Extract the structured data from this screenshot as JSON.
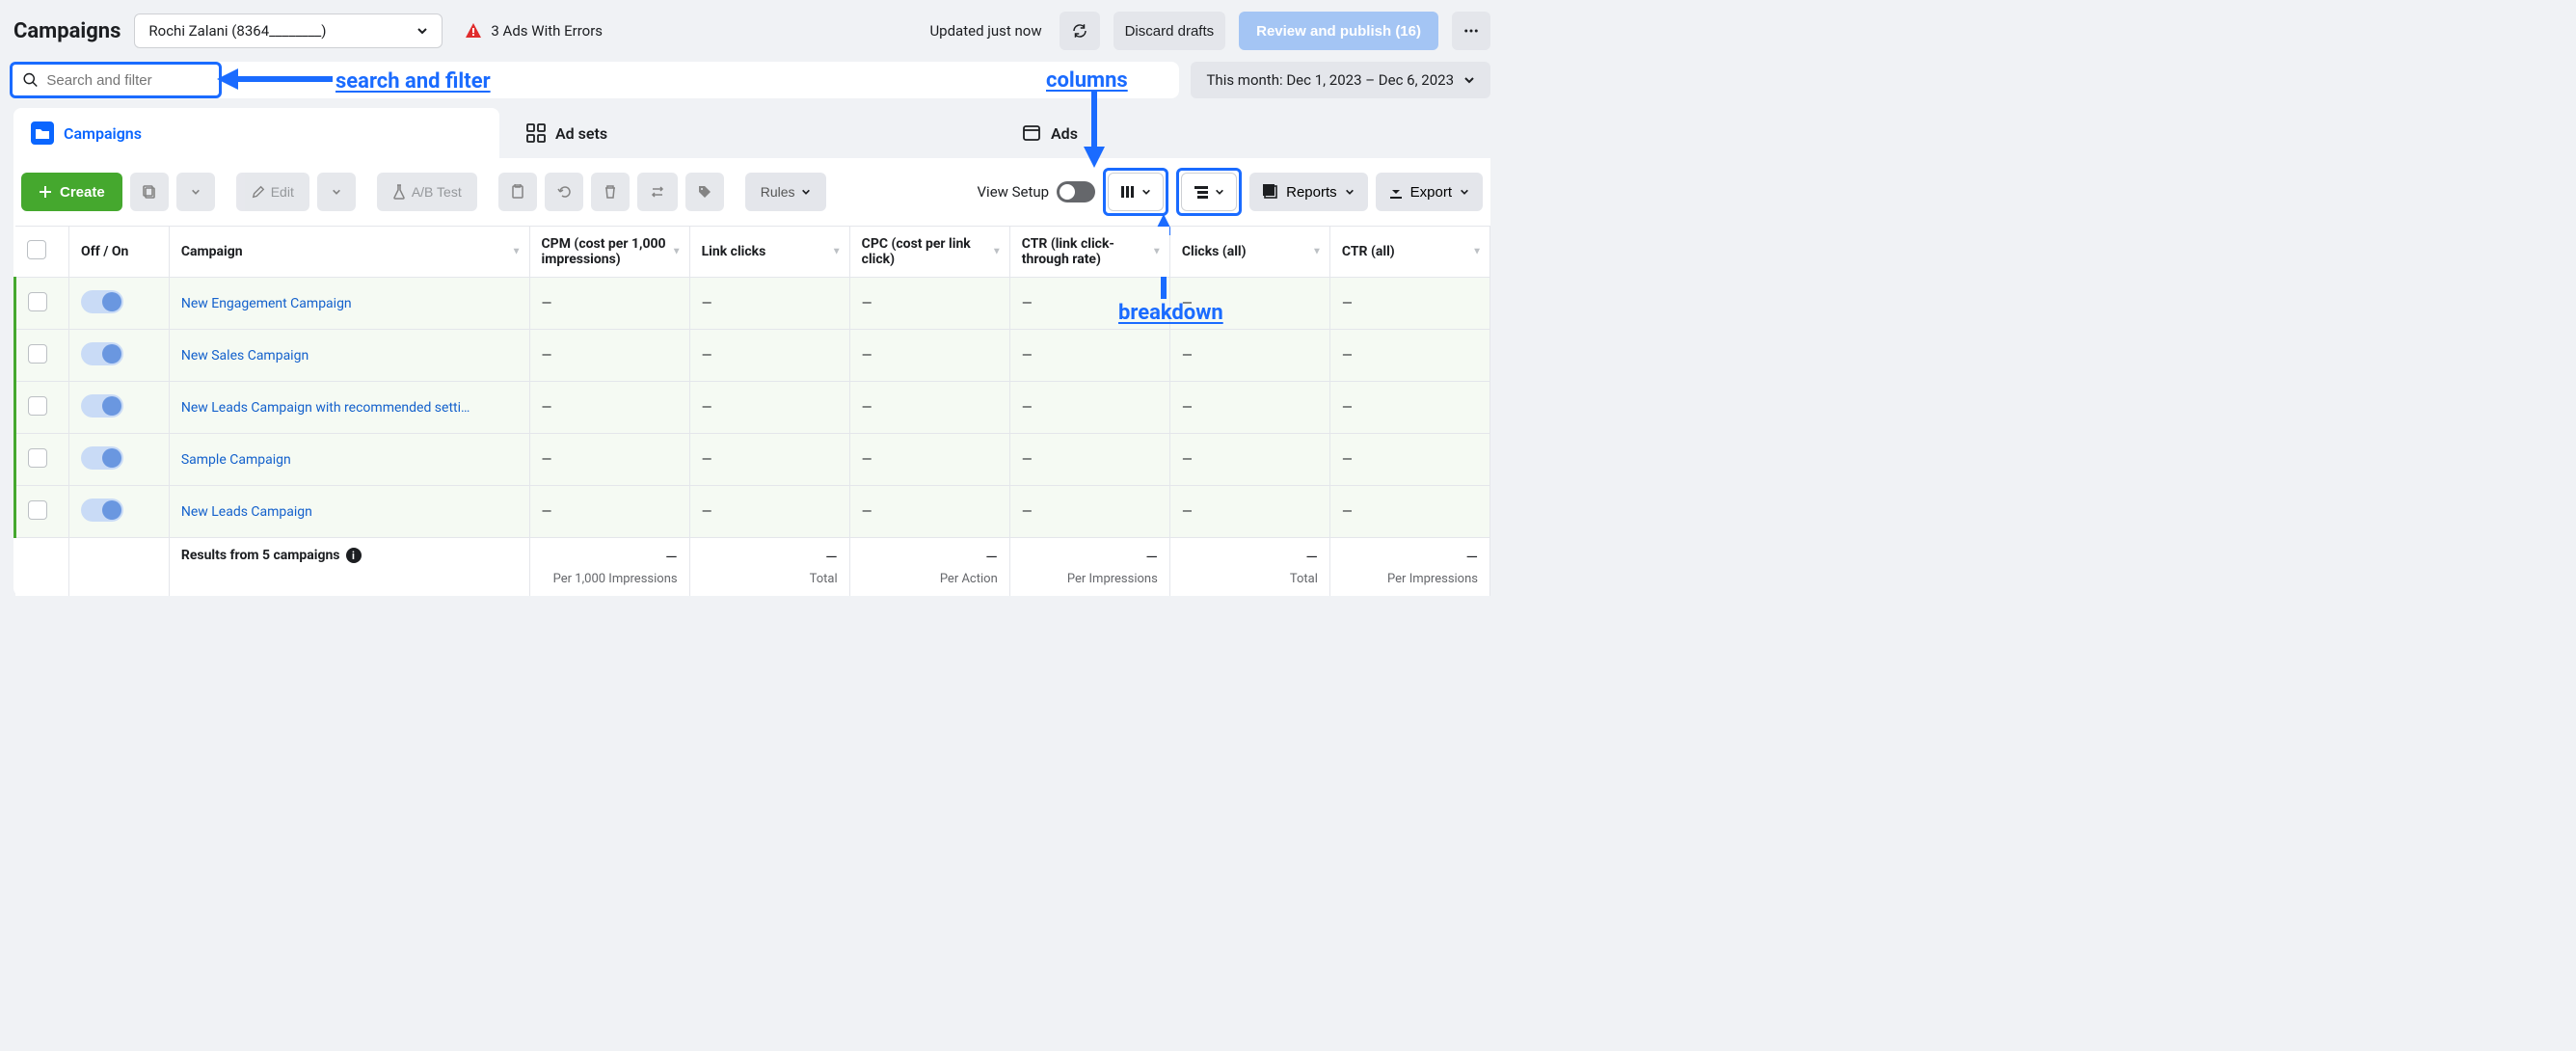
{
  "header": {
    "title": "Campaigns",
    "account_name": "Rochi Zalani (8364________)",
    "error_text": "3 Ads With Errors",
    "updated_text": "Updated just now",
    "discard_label": "Discard drafts",
    "review_label": "Review and publish (16)"
  },
  "search": {
    "placeholder": "Search and filter"
  },
  "date": {
    "label": "This month: Dec 1, 2023 – Dec 6, 2023"
  },
  "annotations": {
    "search": "search and filter",
    "columns": "columns",
    "breakdown": "breakdown"
  },
  "tabs": {
    "campaigns": "Campaigns",
    "adsets": "Ad sets",
    "ads": "Ads"
  },
  "toolbar": {
    "create": "Create",
    "edit": "Edit",
    "abtest": "A/B Test",
    "rules": "Rules",
    "viewsetup": "View Setup",
    "reports": "Reports",
    "export": "Export"
  },
  "columns": {
    "offon": "Off / On",
    "campaign": "Campaign",
    "cpm": "CPM (cost per 1,000 impressions)",
    "linkclicks": "Link clicks",
    "cpc": "CPC (cost per link click)",
    "ctr": "CTR (link click-through rate)",
    "clicksall": "Clicks (all)",
    "ctrall": "CTR (all)"
  },
  "rows": [
    {
      "name": "New Engagement Campaign"
    },
    {
      "name": "New Sales Campaign"
    },
    {
      "name": "New Leads Campaign with recommended setti…"
    },
    {
      "name": "Sample Campaign"
    },
    {
      "name": "New Leads Campaign"
    }
  ],
  "footer": {
    "label": "Results from 5 campaigns",
    "cpm_sub": "Per 1,000 Impressions",
    "linkclicks_sub": "Total",
    "cpc_sub": "Per Action",
    "ctr_sub": "Per Impressions",
    "clicksall_sub": "Total",
    "ctrall_sub": "Per Impressions"
  }
}
